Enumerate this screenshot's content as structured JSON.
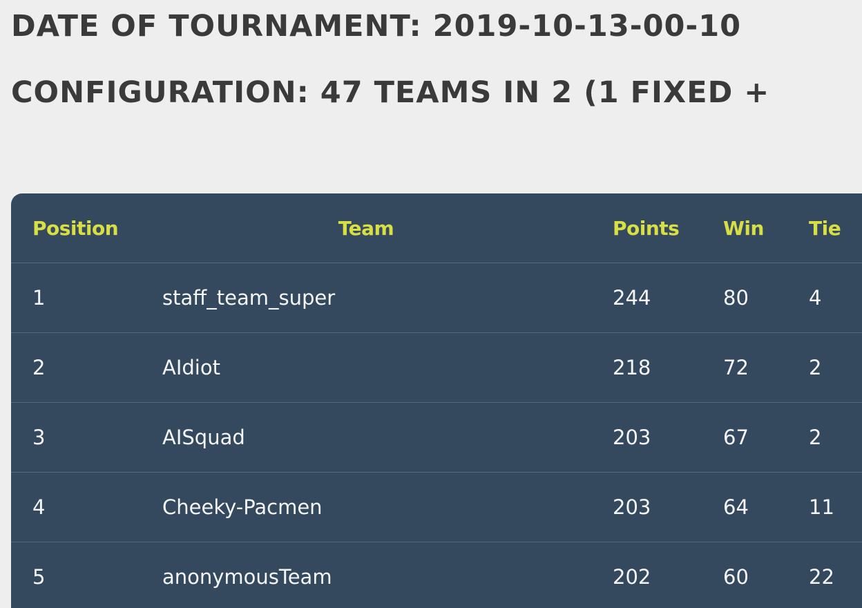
{
  "header": {
    "date_line": "DATE OF TOURNAMENT: 2019-10-13-00-10",
    "config_line": "CONFIGURATION: 47 TEAMS IN 2 (1 FIXED +"
  },
  "table": {
    "columns": {
      "position": "Position",
      "team": "Team",
      "points": "Points",
      "win": "Win",
      "tie": "Tie"
    },
    "rows": [
      {
        "position": "1",
        "team": "staff_team_super",
        "points": "244",
        "win": "80",
        "tie": "4"
      },
      {
        "position": "2",
        "team": "AIdiot",
        "points": "218",
        "win": "72",
        "tie": "2"
      },
      {
        "position": "3",
        "team": "AISquad",
        "points": "203",
        "win": "67",
        "tie": "2"
      },
      {
        "position": "4",
        "team": "Cheeky-Pacmen",
        "points": "203",
        "win": "64",
        "tie": "11"
      },
      {
        "position": "5",
        "team": "anonymousTeam",
        "points": "202",
        "win": "60",
        "tie": "22"
      }
    ]
  },
  "colors": {
    "page_background": "#eeeeee",
    "table_background": "#34495e",
    "header_text": "#d8df44",
    "body_text": "#f3f5f7",
    "heading_text": "#3a3a3a"
  }
}
